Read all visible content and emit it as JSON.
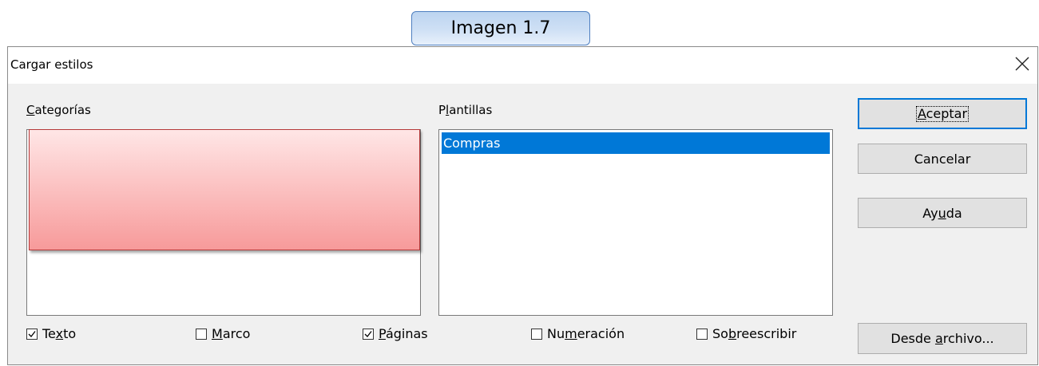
{
  "callout": {
    "label": "Imagen 1.7"
  },
  "window": {
    "title": "Cargar estilos"
  },
  "categories": {
    "label_prefix": "",
    "label_underline": "C",
    "label_rest": "ategorías",
    "items": []
  },
  "templates": {
    "label_prefix": "P",
    "label_underline": "l",
    "label_rest": "antillas",
    "items": [
      "Compras"
    ],
    "selected": "Compras"
  },
  "buttons": {
    "accept": {
      "prefix": "",
      "underline": "A",
      "rest": "ceptar"
    },
    "cancel": {
      "label": "Cancelar"
    },
    "help": {
      "prefix": "Ay",
      "underline": "u",
      "rest": "da"
    },
    "from_file": {
      "prefix": "Desde ",
      "underline": "a",
      "rest": "rchivo..."
    }
  },
  "checkboxes": [
    {
      "prefix": "Te",
      "underline": "x",
      "rest": "to",
      "checked": true
    },
    {
      "prefix": "",
      "underline": "M",
      "rest": "arco",
      "checked": false
    },
    {
      "prefix": "",
      "underline": "P",
      "rest": "áginas",
      "checked": true
    },
    {
      "prefix": "Nu",
      "underline": "m",
      "rest": "eración",
      "checked": false
    },
    {
      "prefix": "So",
      "underline": "b",
      "rest": "reescribir",
      "checked": false
    }
  ]
}
